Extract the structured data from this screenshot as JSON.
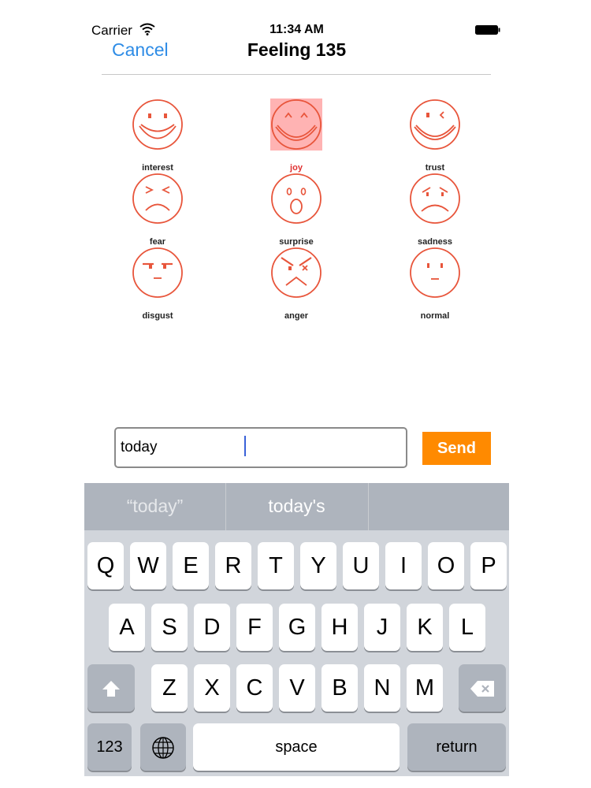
{
  "status_bar": {
    "carrier": "Carrier",
    "time": "11:34 AM"
  },
  "nav": {
    "cancel_label": "Cancel",
    "title": "Feeling 135"
  },
  "faces": [
    {
      "label": "interest",
      "icon": "interest-face-icon",
      "selected": false
    },
    {
      "label": "joy",
      "icon": "joy-face-icon",
      "selected": true
    },
    {
      "label": "trust",
      "icon": "trust-face-icon",
      "selected": false
    },
    {
      "label": "fear",
      "icon": "fear-face-icon",
      "selected": false
    },
    {
      "label": "surprise",
      "icon": "surprise-face-icon",
      "selected": false
    },
    {
      "label": "sadness",
      "icon": "sadness-face-icon",
      "selected": false
    },
    {
      "label": "disgust",
      "icon": "disgust-face-icon",
      "selected": false
    },
    {
      "label": "anger",
      "icon": "anger-face-icon",
      "selected": false
    },
    {
      "label": "normal",
      "icon": "normal-face-icon",
      "selected": false
    }
  ],
  "message": {
    "value": "today",
    "send_label": "Send"
  },
  "keyboard": {
    "predictions": [
      "“today”",
      "today's",
      ""
    ],
    "row1": [
      "Q",
      "W",
      "E",
      "R",
      "T",
      "Y",
      "U",
      "I",
      "O",
      "P"
    ],
    "row2": [
      "A",
      "S",
      "D",
      "F",
      "G",
      "H",
      "J",
      "K",
      "L"
    ],
    "row3": [
      "Z",
      "X",
      "C",
      "V",
      "B",
      "N",
      "M"
    ],
    "numbers_label": "123",
    "space_label": "space",
    "return_label": "return"
  },
  "colors": {
    "face_stroke": "#e8553b",
    "selected_bg": "#ffb3b3",
    "send_bg": "#ff8a00",
    "link": "#2e8ce6"
  }
}
